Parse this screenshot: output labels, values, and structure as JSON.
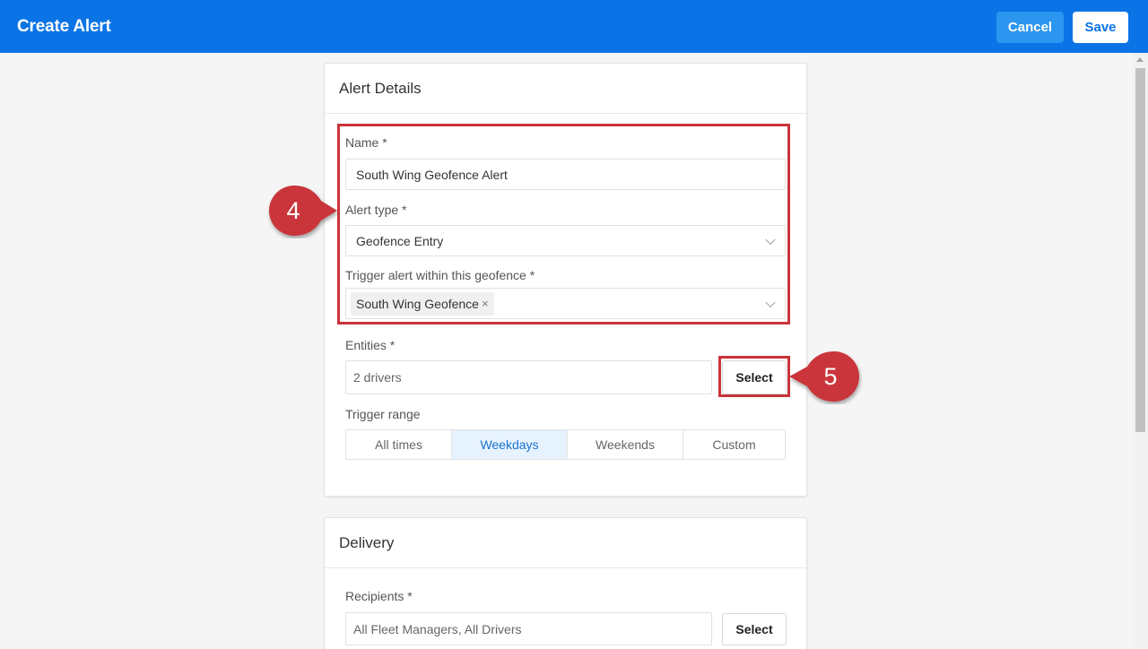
{
  "header": {
    "title": "Create Alert",
    "cancel_label": "Cancel",
    "save_label": "Save"
  },
  "alert_details": {
    "heading": "Alert Details",
    "name": {
      "label": "Name *",
      "value": "South Wing Geofence Alert"
    },
    "alert_type": {
      "label": "Alert type *",
      "value": "Geofence Entry"
    },
    "geofence": {
      "label": "Trigger alert within this geofence *",
      "tag": "South Wing Geofence",
      "remove_glyph": "×"
    },
    "entities": {
      "label": "Entities *",
      "value": "2 drivers",
      "button": "Select"
    },
    "trigger_range": {
      "label": "Trigger range",
      "options": [
        "All times",
        "Weekdays",
        "Weekends",
        "Custom"
      ],
      "selected": "Weekdays"
    }
  },
  "delivery": {
    "heading": "Delivery",
    "recipients": {
      "label": "Recipients *",
      "value": "All Fleet Managers, All Drivers",
      "button": "Select"
    }
  },
  "annotations": {
    "callout_1": "4",
    "callout_2": "5",
    "highlight_color": "#c9343a"
  },
  "colors": {
    "brand": "#0a74e6",
    "active_segment_bg": "#e6f2fd",
    "active_segment_text": "#1a73d0"
  },
  "icons": {
    "chevron": "chevron-down-icon",
    "remove": "close-icon"
  }
}
